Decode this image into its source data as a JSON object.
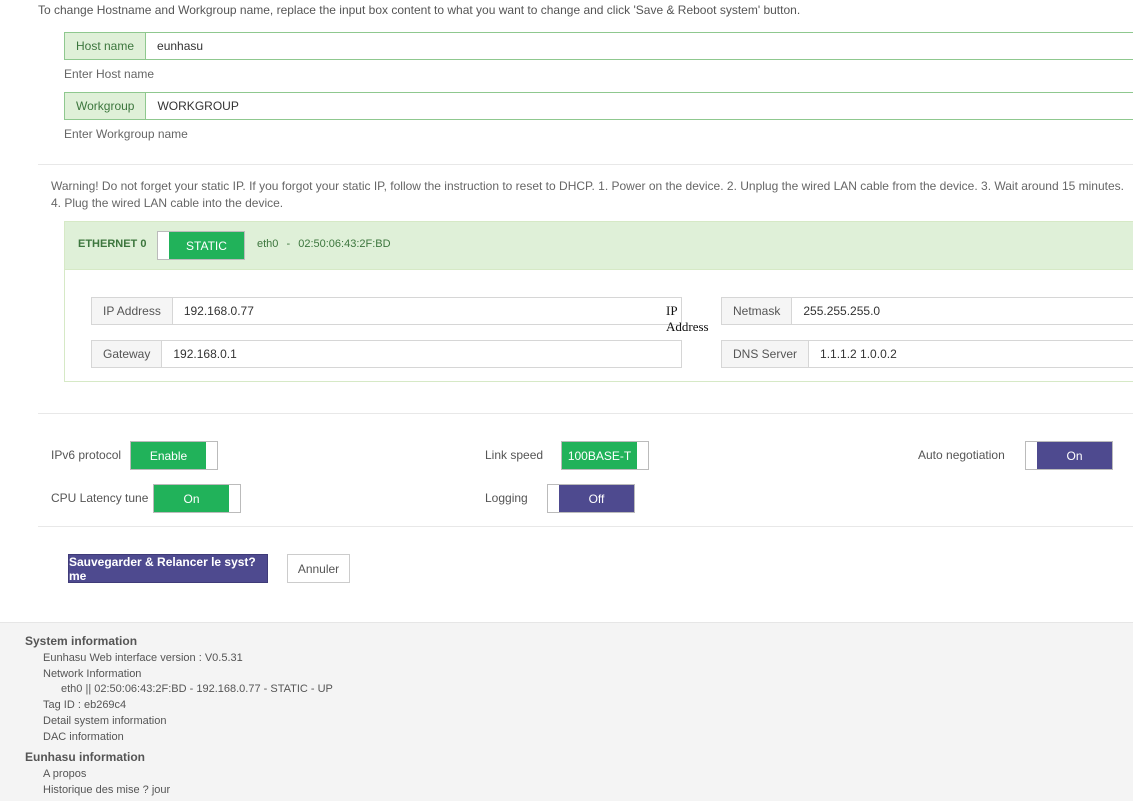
{
  "intro_text": "To change Hostname and Workgroup name, replace the input box content to what you want to change and click 'Save & Reboot system' button.",
  "hostname": {
    "label": "Host name",
    "value": "eunhasu",
    "help": "Enter Host name"
  },
  "workgroup": {
    "label": "Workgroup",
    "value": "WORKGROUP",
    "help": "Enter Workgroup name"
  },
  "warning_text": "Warning! Do not forget your static IP. If you forgot your static IP, follow the instruction to reset to DHCP. 1. Power on the device. 2. Unplug the wired LAN cable from the device. 3. Wait around 15 minutes. 4. Plug the wired LAN cable into the device.",
  "ethernet": {
    "title": "ETHERNET 0",
    "mode": "STATIC",
    "iface": "eth0",
    "separator": "-",
    "mac": "02:50:06:43:2F:BD",
    "ip": {
      "label": "IP Address",
      "value": "192.168.0.77"
    },
    "netmask": {
      "label": "Netmask",
      "value": "255.255.255.0"
    },
    "gateway": {
      "label": "Gateway",
      "value": "192.168.0.1"
    },
    "dns": {
      "label": "DNS Server",
      "value": "1.1.1.2 1.0.0.2"
    },
    "tooltip_line1": "IP",
    "tooltip_line2": "Address"
  },
  "options": {
    "ipv6": {
      "label": "IPv6 protocol",
      "value": "Enable"
    },
    "link_speed": {
      "label": "Link speed",
      "value": "100BASE-T"
    },
    "auto_negotiation": {
      "label": "Auto negotiation",
      "value": "On"
    },
    "cpu_latency": {
      "label": "CPU Latency tune",
      "value": "On"
    },
    "logging": {
      "label": "Logging",
      "value": "Off"
    }
  },
  "buttons": {
    "save": "Sauvegarder & Relancer le syst?me",
    "cancel": "Annuler"
  },
  "footer": {
    "system_title": "System information",
    "version": "Eunhasu Web interface version : V0.5.31",
    "network_info": "Network Information",
    "network_line": "eth0 || 02:50:06:43:2F:BD - 192.168.0.77 - STATIC - UP",
    "tag_id": "Tag ID : eb269c4",
    "detail": "Detail system information",
    "dac": "DAC information",
    "eunhasu_title": "Eunhasu information",
    "apropos": "A propos",
    "history": "Historique des mise ? jour"
  },
  "colors": {
    "green": "#21b25a",
    "purple": "#4e4a8f",
    "panel_green": "#dff0d8"
  }
}
